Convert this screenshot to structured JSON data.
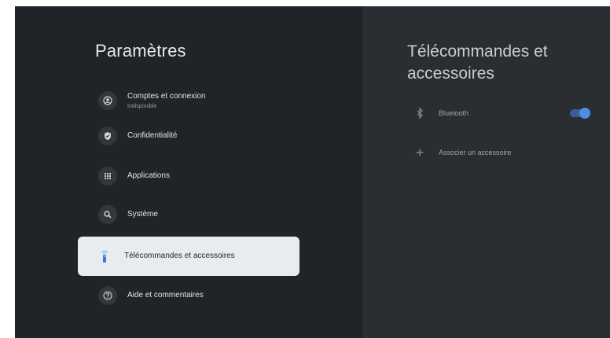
{
  "settings": {
    "title": "Paramètres",
    "items": [
      {
        "label": "Comptes et connexion",
        "sublabel": "Indisponible",
        "icon": "account-circle-icon"
      },
      {
        "label": "Confidentialité",
        "icon": "shield-icon"
      },
      {
        "label": "Applications",
        "icon": "apps-grid-icon"
      },
      {
        "label": "Système",
        "icon": "search-icon"
      },
      {
        "label": "Télécommandes et accessoires",
        "icon": "remote-icon",
        "selected": true
      },
      {
        "label": "Aide et commentaires",
        "icon": "help-icon"
      }
    ]
  },
  "detail": {
    "title": "Télécommandes et accessoires",
    "rows": [
      {
        "label": "Bluetooth",
        "icon": "bluetooth-icon",
        "toggle_on": true
      },
      {
        "label": "Associer un accessoire",
        "icon": "plus-icon"
      }
    ]
  },
  "colors": {
    "accent": "#4d8de8",
    "background": "#1f2226",
    "selected_bg": "#e9ecef"
  }
}
